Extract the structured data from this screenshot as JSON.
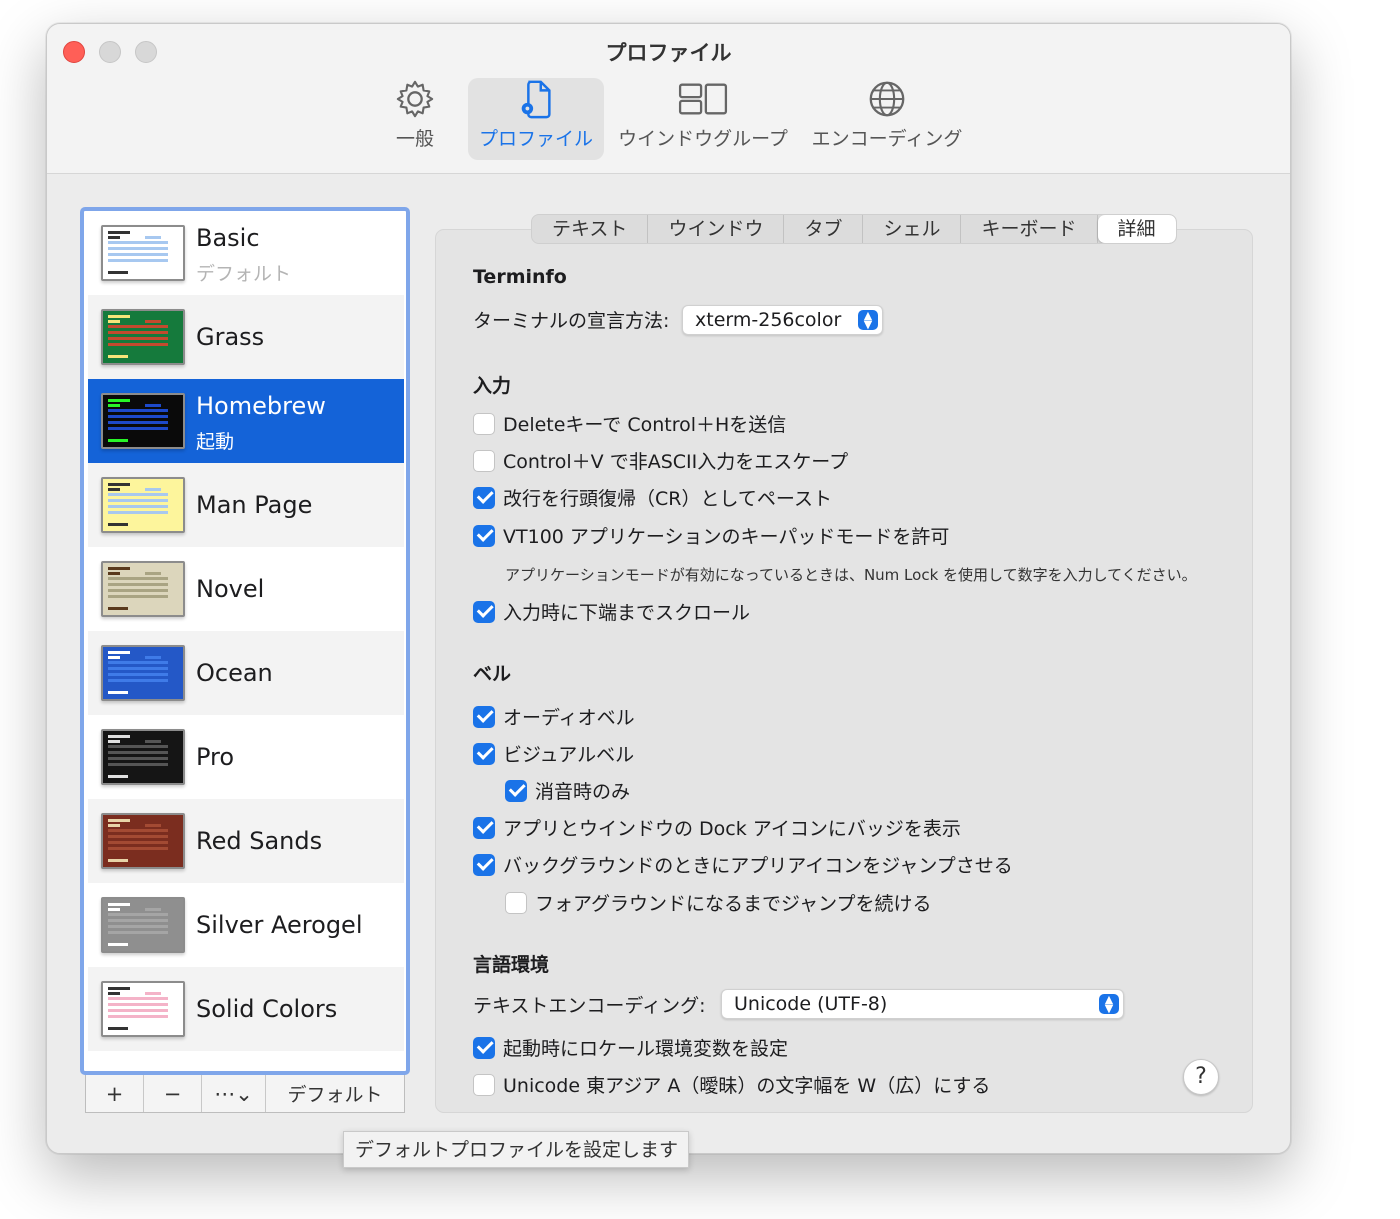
{
  "window": {
    "title": "プロファイル"
  },
  "toolbar": [
    {
      "label": "一般",
      "icon": "gear-icon"
    },
    {
      "label": "プロファイル",
      "icon": "profile-document-icon",
      "selected": true
    },
    {
      "label": "ウインドウグループ",
      "icon": "window-group-icon"
    },
    {
      "label": "エンコーディング",
      "icon": "globe-icon"
    }
  ],
  "profiles": [
    {
      "name": "Basic",
      "sub": "デフォルト",
      "bg": "#ffffff",
      "fg": "#333333",
      "accent": "#a7c8f0"
    },
    {
      "name": "Grass",
      "sub": "",
      "bg": "#157a3c",
      "fg": "#f7e57a",
      "accent": "#c44a2e"
    },
    {
      "name": "Homebrew",
      "sub": "起動",
      "bg": "#0a0a0a",
      "fg": "#28f528",
      "accent": "#1d49c9",
      "selected": true
    },
    {
      "name": "Man Page",
      "sub": "",
      "bg": "#fdf59c",
      "fg": "#333333",
      "accent": "#a8c8ee"
    },
    {
      "name": "Novel",
      "sub": "",
      "bg": "#dcd6bc",
      "fg": "#5a3a1d",
      "accent": "#a9a483"
    },
    {
      "name": "Ocean",
      "sub": "",
      "bg": "#2458c7",
      "fg": "#ffffff",
      "accent": "#3f7be8"
    },
    {
      "name": "Pro",
      "sub": "",
      "bg": "#151515",
      "fg": "#e0e0e0",
      "accent": "#555555"
    },
    {
      "name": "Red Sands",
      "sub": "",
      "bg": "#7b2d1f",
      "fg": "#e8d4a8",
      "accent": "#a34a33"
    },
    {
      "name": "Silver Aerogel",
      "sub": "",
      "bg": "#8f8f8f",
      "fg": "#ffffff",
      "accent": "#a5a5a5"
    },
    {
      "name": "Solid Colors",
      "sub": "",
      "bg": "#ffffff",
      "fg": "#333333",
      "accent": "#f4b3c8"
    }
  ],
  "sidebar_buttons": {
    "add": "+",
    "remove": "−",
    "more": "⋯⌄",
    "default": "デフォルト"
  },
  "tabs": [
    "テキスト",
    "ウインドウ",
    "タブ",
    "シェル",
    "キーボード",
    "詳細"
  ],
  "selected_tab": "詳細",
  "terminfo": {
    "heading": "Terminfo",
    "label": "ターミナルの宣言方法:",
    "value": "xterm-256color"
  },
  "input": {
    "heading": "入力",
    "options": [
      {
        "label": "Deleteキーで Control＋Hを送信",
        "checked": false
      },
      {
        "label": "Control＋V で非ASCII入力をエスケープ",
        "checked": false
      },
      {
        "label": "改行を行頭復帰（CR）としてペースト",
        "checked": true
      },
      {
        "label": "VT100 アプリケーションのキーパッドモードを許可",
        "checked": true
      }
    ],
    "note": "アプリケーションモードが有効になっているときは、Num Lock を使用して数字を入力してください。",
    "scroll": {
      "label": "入力時に下端までスクロール",
      "checked": true
    }
  },
  "bell": {
    "heading": "ベル",
    "audio": {
      "label": "オーディオベル",
      "checked": true
    },
    "visual": {
      "label": "ビジュアルベル",
      "checked": true
    },
    "mute_only": {
      "label": "消音時のみ",
      "checked": true
    },
    "dock_badge": {
      "label": "アプリとウインドウの Dock アイコンにバッジを表示",
      "checked": true
    },
    "bounce": {
      "label": "バックグラウンドのときにアプリアイコンをジャンプさせる",
      "checked": true
    },
    "bounce_until": {
      "label": "フォアグラウンドになるまでジャンプを続ける",
      "checked": false
    }
  },
  "locale": {
    "heading": "言語環境",
    "encoding_label": "テキストエンコーディング:",
    "encoding_value": "Unicode (UTF-8)",
    "set_locale": {
      "label": "起動時にロケール環境変数を設定",
      "checked": true
    },
    "east_asian": {
      "label": "Unicode 東アジア A（曖昧）の文字幅を W（広）にする",
      "checked": false
    }
  },
  "help": "?",
  "tooltip": "デフォルトプロファイルを設定します"
}
